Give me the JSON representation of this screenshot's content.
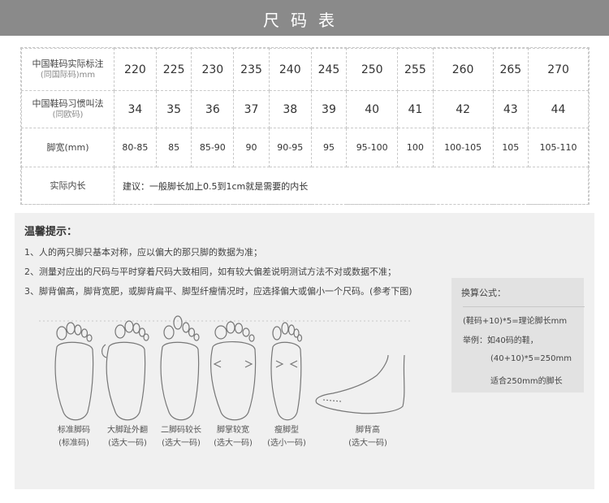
{
  "header": {
    "title": "尺码表"
  },
  "size_table": {
    "rows": [
      {
        "label": "中国鞋码实际标注",
        "sub": "(同国际码)mm",
        "values": [
          "220",
          "225",
          "230",
          "235",
          "240",
          "245",
          "250",
          "255",
          "260",
          "265",
          "270"
        ]
      },
      {
        "label": "中国鞋码习惯叫法",
        "sub": "(同欧码)",
        "values": [
          "34",
          "35",
          "36",
          "37",
          "38",
          "39",
          "40",
          "41",
          "42",
          "43",
          "44"
        ]
      },
      {
        "label": "脚宽(mm)",
        "sub": "",
        "values": [
          "80-85",
          "85",
          "85-90",
          "90",
          "90-95",
          "95",
          "95-100",
          "100",
          "100-105",
          "105",
          "105-110"
        ]
      }
    ],
    "inner_length": {
      "label": "实际内长",
      "note": "建议：一般脚长加上0.5到1cm就是需要的内长"
    }
  },
  "tips": {
    "title": "温馨提示：",
    "items": [
      "1、人的两只脚只基本对称，应以偏大的那只脚的数据为准；",
      "2、测量对应出的尺码与平时穿着尺码大致相同，如有较大偏差说明测试方法不对或数据不准；",
      "3、脚背偏高，脚背宽肥，或脚背扁平、脚型纤瘦情况时，应选择偏大或偏小一个尺码。(参考下图)"
    ]
  },
  "formula": {
    "title": "换算公式：",
    "lines": [
      "(鞋码+10)*5=理论脚长mm",
      "举例：如40码的鞋，",
      "(40+10)*5=250mm",
      "适合250mm的脚长"
    ]
  },
  "foot_types": [
    {
      "name": "标准脚码",
      "advice": "(标准码)"
    },
    {
      "name": "大脚趾外翻",
      "advice": "(选大一码)"
    },
    {
      "name": "二脚码较长",
      "advice": "(选大一码)"
    },
    {
      "name": "脚掌较宽",
      "advice": "(选大一码)"
    },
    {
      "name": "瘦脚型",
      "advice": "(选小一码)"
    },
    {
      "name": "脚背高",
      "advice": "(选大一码)"
    }
  ]
}
